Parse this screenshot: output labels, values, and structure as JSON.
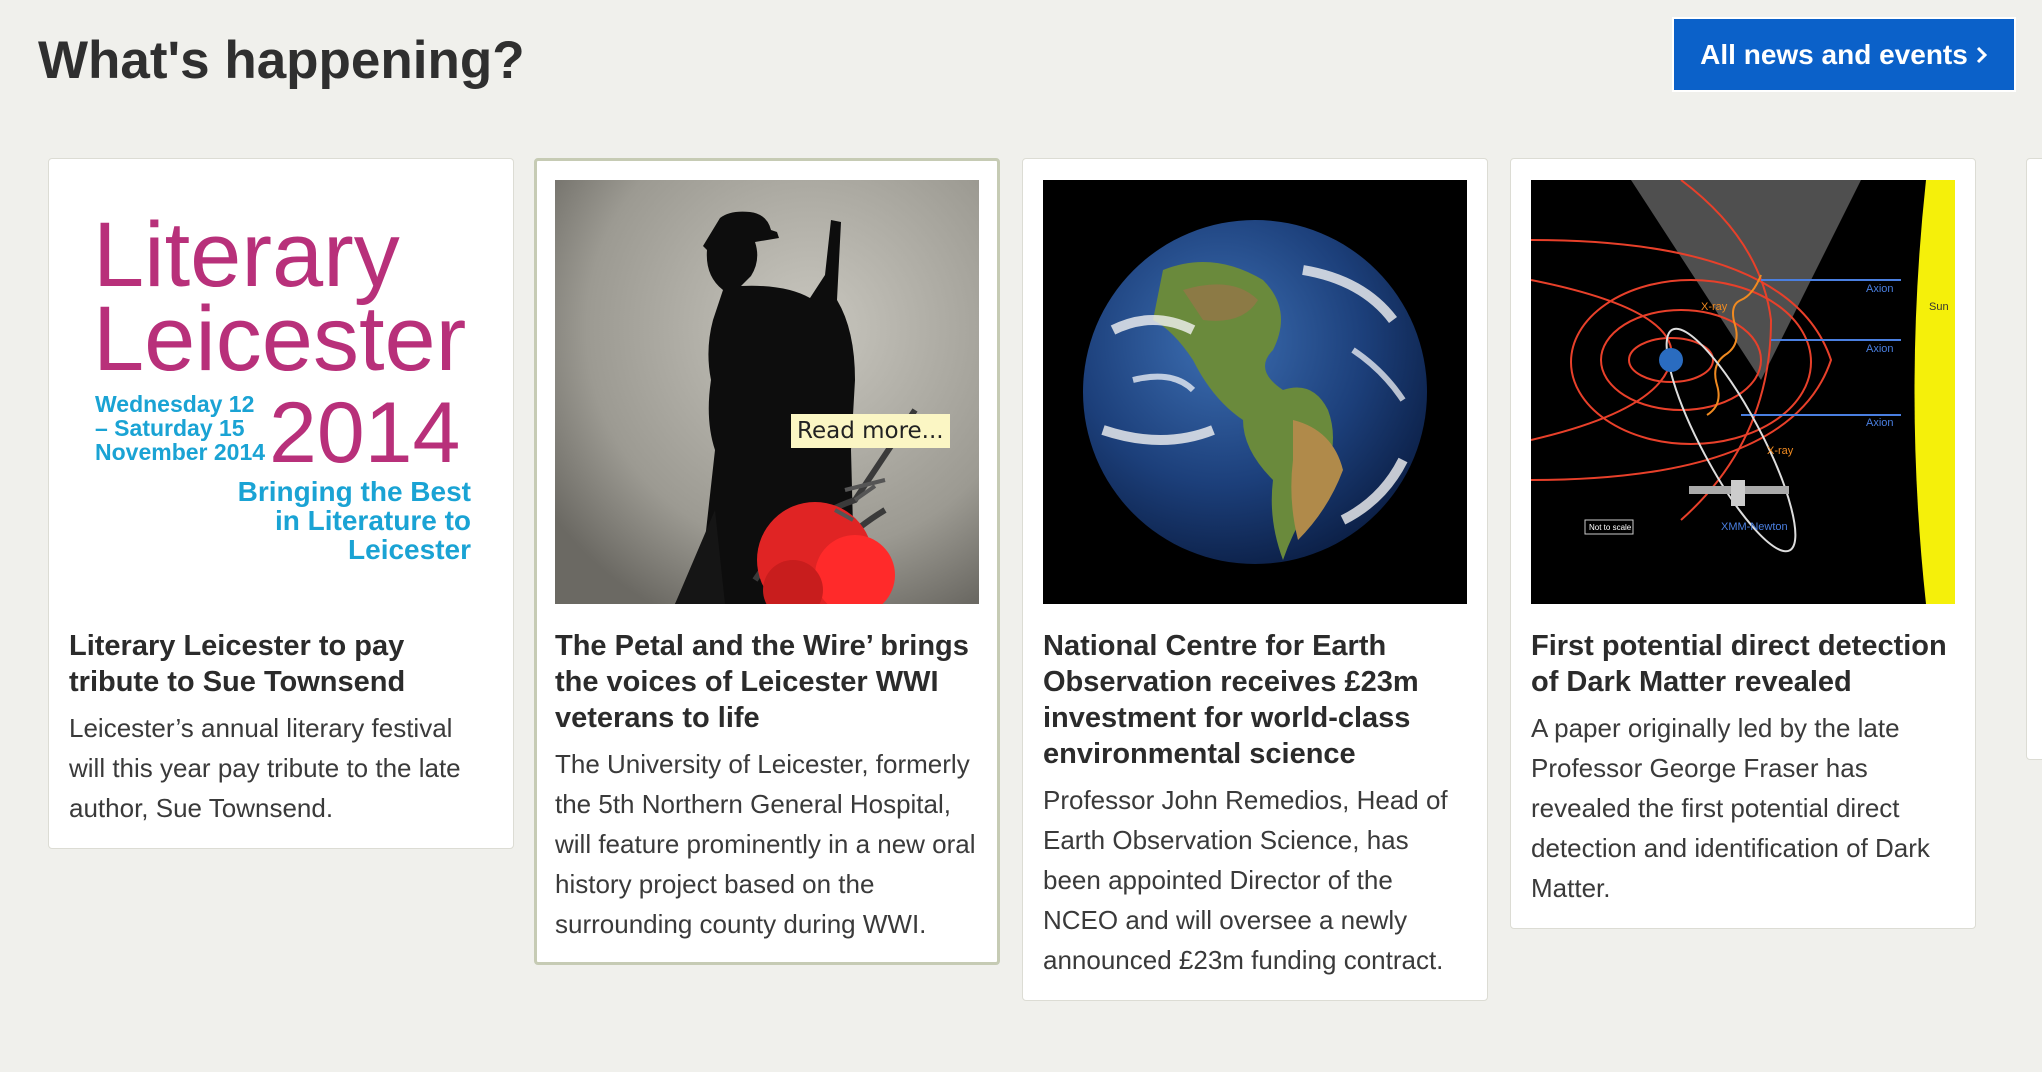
{
  "header": {
    "title": "What's happening?",
    "all_news_label": "All news and events",
    "all_news_icon": "chevron-right-icon"
  },
  "cards": [
    {
      "logo": {
        "line1": "Literary",
        "line2": "Leicester",
        "dates": [
          "Wednesday 12",
          "– Saturday 15",
          "November 2014"
        ],
        "year": "2014",
        "tagline": [
          "Bringing the Best",
          "in Literature to",
          "Leicester"
        ],
        "pink": "#b8307a",
        "blue": "#1aa3d4"
      },
      "title": "Literary Leicester to pay tribute to Sue Townsend",
      "summary": "Leicester’s annual literary festival will this year pay tribute to the late author, Sue Townsend."
    },
    {
      "overlay": "Read more...",
      "title": "The Petal and the Wire’ brings the voices of Leicester WWI veterans to life",
      "summary": "The University of Leicester, formerly the 5th Northern General Hospital, will feature prominently in a new oral history project based on the surrounding county during WWI."
    },
    {
      "title": "National Centre for Earth Observation receives £23m investment for world-class environmental science",
      "summary": "Professor John Remedios, Head of Earth Observation Science, has been appointed Director of the NCEO and will oversee a newly announced £23m funding contract."
    },
    {
      "diagram": {
        "labels": [
          "X-ray",
          "Axion",
          "Axion",
          "Axion",
          "Sun",
          "X-ray",
          "Not to scale",
          "XMM-Newton"
        ]
      },
      "title": "First potential direct detection of Dark Matter revealed",
      "summary": "A paper originally led by the late Professor George Fraser has revealed the first potential direct detection and identification of Dark Matter."
    }
  ]
}
